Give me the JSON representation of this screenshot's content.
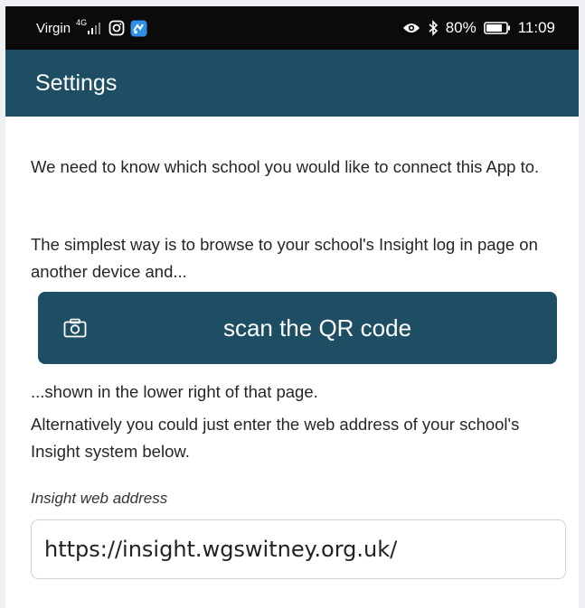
{
  "status_bar": {
    "carrier": "Virgin",
    "network": "4G",
    "battery": "80%",
    "time": "11:09",
    "icons": [
      "signal-icon",
      "instagram-icon",
      "app-notification-icon",
      "eye-icon",
      "bluetooth-icon",
      "battery-icon"
    ]
  },
  "app_bar": {
    "title": "Settings"
  },
  "main": {
    "intro": "We need to know which school you would like to connect this App to.",
    "instructions": "The simplest way is to browse to your school's Insight log in page on another device and...",
    "scan_button_label": "scan the QR code",
    "scan_icon": "camera-icon",
    "after_scan": "...shown in the lower right of that page.",
    "alternative": "Alternatively you could just enter the web address of your school's Insight system below.",
    "address_label": "Insight web address",
    "address_value": "https://insight.wgswitney.org.uk/"
  },
  "colors": {
    "app_bar": "#1d4e63",
    "button": "#1d4e63",
    "status_bar": "#0b0b0c"
  }
}
